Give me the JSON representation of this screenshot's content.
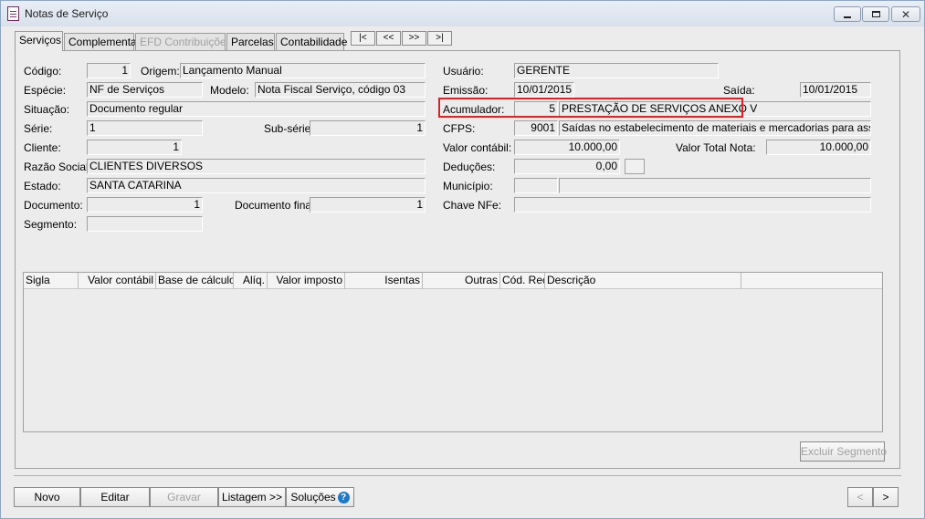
{
  "window": {
    "title": "Notas de Serviço"
  },
  "tabs": [
    {
      "label": "Serviços",
      "active": true
    },
    {
      "label": "Complementar"
    },
    {
      "label": "EFD Contribuições",
      "disabled": true
    },
    {
      "label": "Parcelas"
    },
    {
      "label": "Contabilidade"
    }
  ],
  "nav": {
    "first": "|<",
    "prev": "<<",
    "next": ">>",
    "last": ">|"
  },
  "form": {
    "codigo_label": "Código:",
    "codigo": "1",
    "origem_label": "Origem:",
    "origem": "Lançamento Manual",
    "especie_label": "Espécie:",
    "especie": "NF de Serviços",
    "modelo_label": "Modelo:",
    "modelo": "Nota Fiscal Serviço, código 03",
    "situacao_label": "Situação:",
    "situacao": "Documento regular",
    "serie_label": "Série:",
    "serie": "1",
    "subserie_label": "Sub-série:",
    "subserie": "1",
    "cliente_label": "Cliente:",
    "cliente": "1",
    "razao_label": "Razão Social:",
    "razao": "CLIENTES DIVERSOS",
    "estado_label": "Estado:",
    "estado": "SANTA CATARINA",
    "documento_label": "Documento:",
    "documento": "1",
    "docfinal_label": "Documento final:",
    "docfinal": "1",
    "segmento_label": "Segmento:",
    "segmento": "",
    "usuario_label": "Usuário:",
    "usuario": "GERENTE",
    "emissao_label": "Emissão:",
    "emissao": "10/01/2015",
    "saida_label": "Saída:",
    "saida": "10/01/2015",
    "acumulador_label": "Acumulador:",
    "acumulador_code": "5",
    "acumulador_desc": "PRESTAÇÃO DE SERVIÇOS ANEXO V",
    "cfps_label": "CFPS:",
    "cfps_code": "9001",
    "cfps_desc": "Saídas no estabelecimento de materiais e mercadorias para assistência",
    "valor_contabil_label": "Valor contábil:",
    "valor_contabil": "10.000,00",
    "valor_total_label": "Valor Total Nota:",
    "valor_total": "10.000,00",
    "deducoes_label": "Deduções:",
    "deducoes": "0,00",
    "deducoes_btn": "...",
    "municipio_label": "Município:",
    "municipio_code": "",
    "municipio_name": "",
    "chave_label": "Chave NFe:",
    "chave": ""
  },
  "grid": {
    "columns": [
      "Sigla",
      "Valor contábil",
      "Base de cálculo",
      "Alíq.",
      "Valor imposto",
      "Isentas",
      "Outras",
      "Cód. Rec.",
      "Descrição"
    ]
  },
  "buttons": {
    "excluir_segmento": "Excluir Segmento",
    "novo": "Novo",
    "editar": "Editar",
    "gravar": "Gravar",
    "listagem": "Listagem >>",
    "solucoes": "Soluções",
    "prev": "<",
    "next": ">"
  },
  "colors": {
    "highlight": "#e02020",
    "help": "#1e78c8"
  }
}
